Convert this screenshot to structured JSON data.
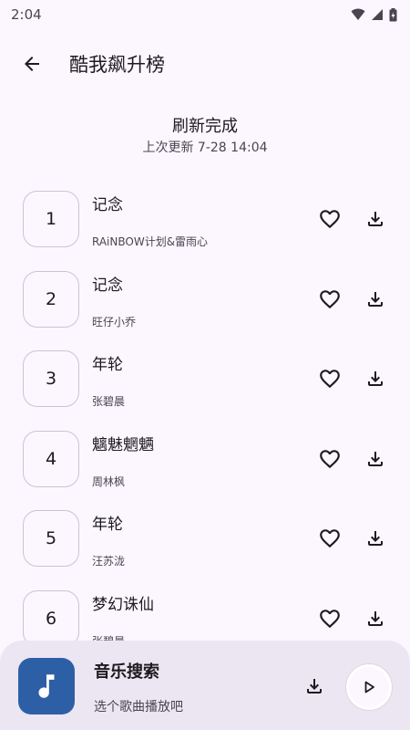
{
  "status_bar": {
    "time": "2:04",
    "icons": [
      "wifi-icon",
      "signal-icon",
      "battery-icon"
    ]
  },
  "header": {
    "title": "酷我飙升榜",
    "back_icon": "arrow-left-icon"
  },
  "refresh": {
    "title": "刷新完成",
    "last_update": "上次更新 7-28 14:04"
  },
  "songs": [
    {
      "rank": "1",
      "title": "记念",
      "artist": "RAiNBOW计划&雷雨心"
    },
    {
      "rank": "2",
      "title": "记念",
      "artist": "旺仔小乔"
    },
    {
      "rank": "3",
      "title": "年轮",
      "artist": "张碧晨"
    },
    {
      "rank": "4",
      "title": "魑魅魍魉",
      "artist": "周林枫"
    },
    {
      "rank": "5",
      "title": "年轮",
      "artist": "汪苏泷"
    },
    {
      "rank": "6",
      "title": "梦幻诛仙",
      "artist": "张碧晨"
    }
  ],
  "player": {
    "title": "音乐搜索",
    "subtitle": "选个歌曲播放吧",
    "icons": [
      "music-note-icon",
      "download-icon",
      "play-icon"
    ]
  },
  "colors": {
    "background": "#fcf7ff",
    "player_bar": "#ece6f2",
    "album_art": "#2d5fa6",
    "text_primary": "#1c1b1f",
    "text_secondary": "#49454f"
  }
}
